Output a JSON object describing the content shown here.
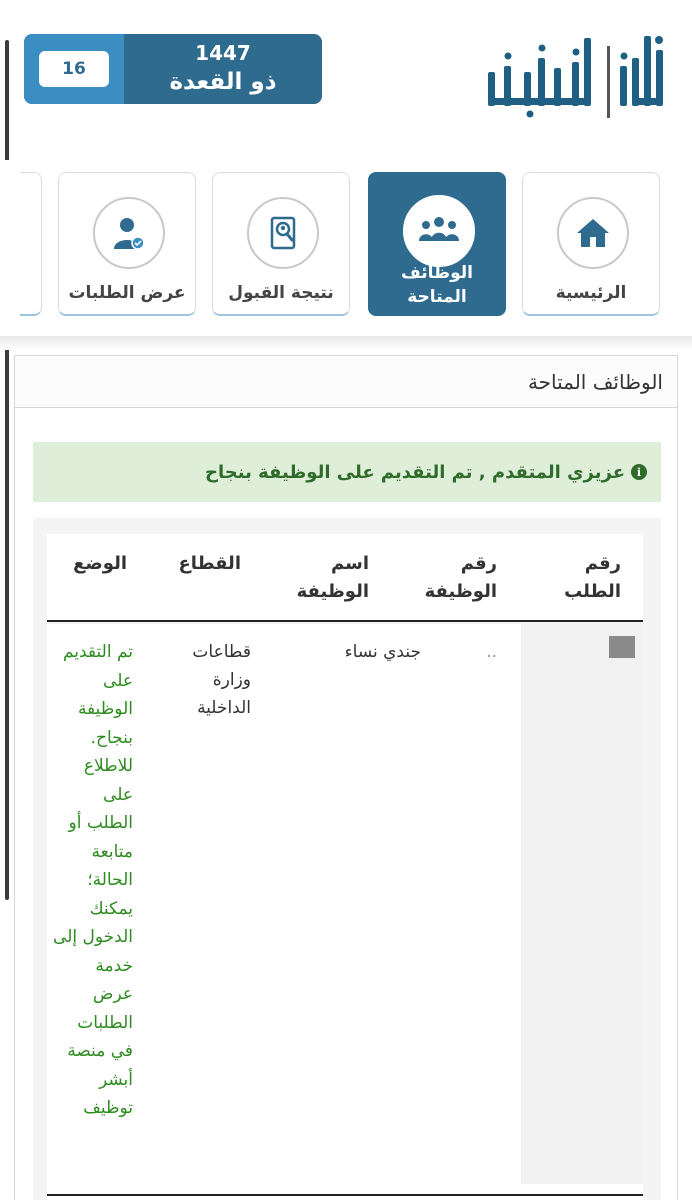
{
  "header": {
    "date": {
      "year": "1447",
      "month": "ذو القعدة",
      "day": "16"
    },
    "logo_text": "أبشر | توظيف"
  },
  "nav": {
    "items": [
      {
        "label": "الرئيسية",
        "icon": "home-icon",
        "active": false
      },
      {
        "label": "الوظائف المتاحة",
        "icon": "team-icon",
        "active": true
      },
      {
        "label": "نتيجة القبول",
        "icon": "search-document-icon",
        "active": false
      },
      {
        "label": "عرض الطلبات",
        "icon": "user-check-icon",
        "active": false
      }
    ]
  },
  "panel": {
    "title": "الوظائف المتاحة",
    "alert": "عزيزي المتقدم , تم التقديم على الوظيفة بنجاح"
  },
  "table": {
    "headers": [
      "رقم الطلب",
      "رقم الوظيفة",
      "اسم الوظيفة",
      "القطاع",
      "الوضع"
    ],
    "rows": [
      {
        "request_no": "",
        "job_no": "..",
        "job_name": "جندي نساء",
        "sector": "قطاعات وزارة الداخلية",
        "status": "تم التقديم على الوظيفة بنجاح. للاطلاع على الطلب أو متابعة الحالة؛ يمكنك الدخول إلى خدمة عرض الطلبات في منصة أبشر توظيف"
      }
    ]
  },
  "colors": {
    "primary": "#2e6b8f",
    "accent": "#3a8ec2",
    "success_bg": "#dfeed9",
    "success_text": "#2e8b1f"
  }
}
